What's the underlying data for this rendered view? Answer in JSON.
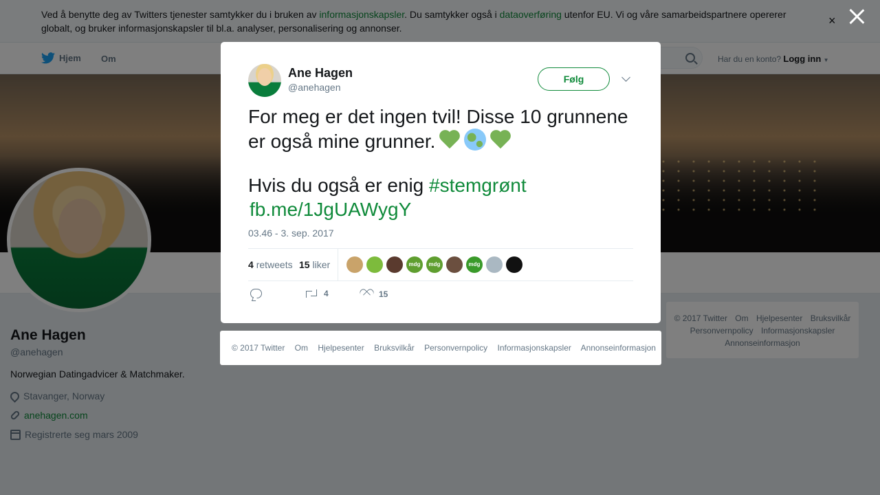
{
  "cookie_banner": {
    "text_1": "Ved å benytte deg av Twitters tjenester samtykker du i bruken av ",
    "link_1": "informasjonskapsler",
    "text_2": ". Du samtykker også i ",
    "link_2": "dataoverføring",
    "text_3": " utenfor EU. Vi og våre samarbeidspartnere opererer globalt, og bruker informasjonskapsler til bl.a. analyser, personalisering og annonser.",
    "close_glyph": "×"
  },
  "nav": {
    "home_label": "Hjem",
    "about_label": "Om",
    "login_prompt": "Har du en konto?",
    "login_label": "Logg inn"
  },
  "profile": {
    "name": "Ane Hagen",
    "handle": "@anehagen",
    "bio": "Norwegian Datingadvicer & Matchmaker.",
    "location": "Stavanger, Norway",
    "website": "anehagen.com",
    "joined": "Registrerte seg mars 2009"
  },
  "tweet": {
    "author_name": "Ane Hagen",
    "author_handle": "@anehagen",
    "follow_label": "Følg",
    "text_line_1": "For meg er det ingen tvil! Disse 10 grunnene er også mine grunner.",
    "text_line_2": "Hvis du også er enig ",
    "hashtag": "#stemgrønt",
    "link": "fb.me/1JgUAWygY",
    "timestamp": "03.46 - 3. sep. 2017",
    "retweet_count": "4",
    "retweet_label": "retweets",
    "like_count": "15",
    "like_label": "liker",
    "action_retweet_count": "4",
    "action_like_count": "15",
    "likers": [
      {
        "label": "",
        "color": "#c9a36a"
      },
      {
        "label": "",
        "color": "#7dbb3c"
      },
      {
        "label": "",
        "color": "#5a3a2e"
      },
      {
        "label": "mdg",
        "color": "#5f9e2f"
      },
      {
        "label": "mdg",
        "color": "#5f9e2f"
      },
      {
        "label": "",
        "color": "#6b4f3f"
      },
      {
        "label": "mdg",
        "color": "#3a9a2a"
      },
      {
        "label": "",
        "color": "#aab8c2"
      },
      {
        "label": "",
        "color": "#111111"
      }
    ]
  },
  "footer_links": [
    "© 2017 Twitter",
    "Om",
    "Hjelpesenter",
    "Bruksvilkår",
    "Personvernpolicy",
    "Informasjonskapsler",
    "Annonseinformasjon"
  ],
  "colors": {
    "accent": "#0f8a3a",
    "text": "#14171a",
    "muted": "#657786"
  }
}
